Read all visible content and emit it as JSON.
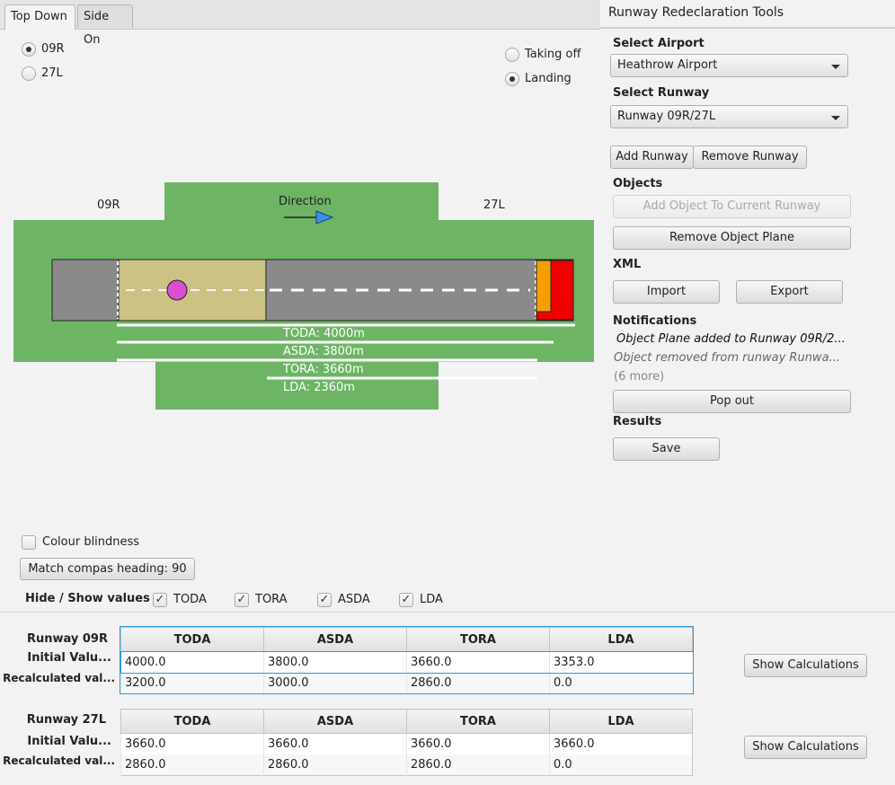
{
  "tabs": [
    {
      "label": "Top Down"
    },
    {
      "label": "Side On"
    }
  ],
  "direction_options": [
    {
      "label": "09R",
      "selected": true
    },
    {
      "label": "27L",
      "selected": false
    }
  ],
  "mode_options": [
    {
      "label": "Taking off",
      "selected": false
    },
    {
      "label": "Landing",
      "selected": true
    }
  ],
  "diagram": {
    "left_label": "09R",
    "right_label": "27L",
    "direction_label": "Direction",
    "bars": [
      {
        "label": "TODA: 4000m"
      },
      {
        "label": "ASDA: 3800m"
      },
      {
        "label": "TORA: 3660m"
      },
      {
        "label": "LDA: 2360m"
      }
    ],
    "colors": {
      "grass": "#6db565",
      "runway": "#8a8a8a",
      "displaced": "#cbc284",
      "object": "#d94fd0",
      "blast": "#ee0000",
      "stopway": "#f5a000",
      "arrow": "#3a8fe8"
    }
  },
  "colour_blindness": {
    "label": "Colour blindness",
    "checked": false
  },
  "match_heading": {
    "label": "Match compas heading: 90"
  },
  "hide_show": {
    "label": "Hide / Show values",
    "items": [
      {
        "label": "TODA",
        "checked": true
      },
      {
        "label": "TORA",
        "checked": true
      },
      {
        "label": "ASDA",
        "checked": true
      },
      {
        "label": "LDA",
        "checked": true
      }
    ]
  },
  "tables": [
    {
      "runway": "Runway 09R",
      "row_labels": [
        "Initial Valu...",
        "Recalculated val..."
      ],
      "headers": [
        "TODA",
        "ASDA",
        "TORA",
        "LDA"
      ],
      "rows": [
        [
          "4000.0",
          "3800.0",
          "3660.0",
          "3353.0"
        ],
        [
          "3200.0",
          "3000.0",
          "2860.0",
          "0.0"
        ]
      ],
      "button": "Show Calculations"
    },
    {
      "runway": "Runway 27L",
      "row_labels": [
        "Initial Valu...",
        "Recalculated val..."
      ],
      "headers": [
        "TODA",
        "ASDA",
        "TORA",
        "LDA"
      ],
      "rows": [
        [
          "3660.0",
          "3660.0",
          "3660.0",
          "3660.0"
        ],
        [
          "2860.0",
          "2860.0",
          "2860.0",
          "0.0"
        ]
      ],
      "button": "Show Calculations"
    }
  ],
  "side": {
    "title": "Runway Redeclaration Tools",
    "airport": {
      "label": "Select Airport",
      "value": "Heathrow Airport"
    },
    "runway": {
      "label": "Select Runway",
      "value": "Runway 09R/27L"
    },
    "add_runway": "Add Runway",
    "remove_runway": "Remove Runway",
    "objects": {
      "label": "Objects",
      "add": "Add Object To Current Runway",
      "remove": "Remove Object Plane"
    },
    "xml": {
      "label": "XML",
      "import": "Import",
      "export": "Export"
    },
    "notifications": {
      "label": "Notifications",
      "items": [
        "Object Plane added to Runway 09R/2...",
        "Object removed from runway Runwa...",
        "(6 more)"
      ],
      "popout": "Pop out"
    },
    "results": {
      "label": "Results",
      "save": "Save"
    }
  }
}
